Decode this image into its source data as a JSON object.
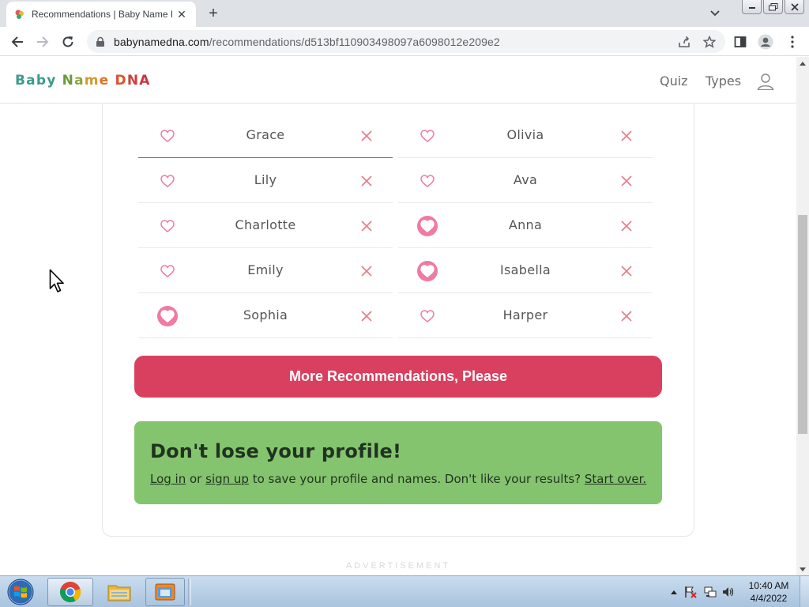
{
  "browser": {
    "tab_title": "Recommendations | Baby Name DNA",
    "url_domain": "babynamedna.com",
    "url_path": "/recommendations/d513bf110903498097a6098012e209e2"
  },
  "site": {
    "logo_text": "Baby Name DNA",
    "nav": {
      "quiz": "Quiz",
      "types": "Types"
    }
  },
  "names": {
    "left": [
      {
        "name": "Grace",
        "liked": false
      },
      {
        "name": "Lily",
        "liked": false
      },
      {
        "name": "Charlotte",
        "liked": false
      },
      {
        "name": "Emily",
        "liked": false
      },
      {
        "name": "Sophia",
        "liked": true
      }
    ],
    "right": [
      {
        "name": "Olivia",
        "liked": false
      },
      {
        "name": "Ava",
        "liked": false
      },
      {
        "name": "Anna",
        "liked": true
      },
      {
        "name": "Isabella",
        "liked": true
      },
      {
        "name": "Harper",
        "liked": false
      }
    ]
  },
  "more_button": "More Recommendations, Please",
  "profile_box": {
    "title": "Don't lose your profile!",
    "login": "Log in",
    "or": " or ",
    "signup": "sign up",
    "middle": " to save your profile and names. Don't like your results? ",
    "start_over": "Start over."
  },
  "ad_label": "ADVERTISEMENT",
  "taskbar": {
    "time": "10:40 AM",
    "date": "4/4/2022"
  },
  "colors": {
    "heart": "#ef7aa3",
    "x": "#e5818f",
    "button": "#d9405f",
    "profile_box": "#85c46e"
  }
}
